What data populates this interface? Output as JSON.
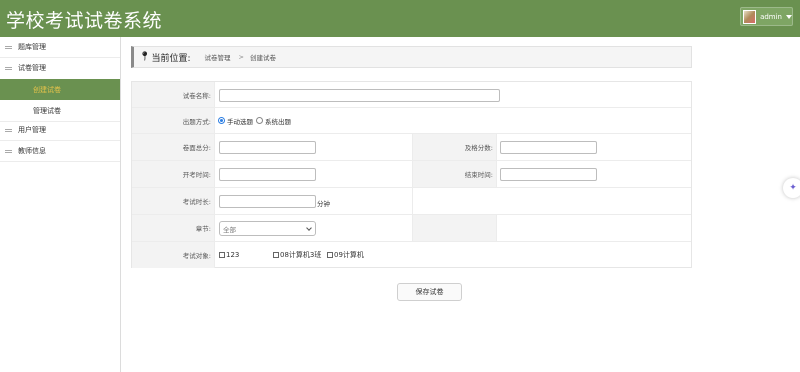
{
  "app": {
    "title": "学校考试试卷系统"
  },
  "user": {
    "name": "admin"
  },
  "sidebar": {
    "items": [
      {
        "label": "题库管理"
      },
      {
        "label": "试卷管理"
      },
      {
        "label": "用户管理"
      },
      {
        "label": "教师信息"
      }
    ],
    "subitems": [
      {
        "label": "创建试卷",
        "active": true
      },
      {
        "label": "管理试卷",
        "active": false
      }
    ]
  },
  "breadcrumb": {
    "prefix": "当前位置:",
    "parent": "试卷管理",
    "separator": ">",
    "current": "创建试卷"
  },
  "form": {
    "name_label": "试卷名称:",
    "name_value": "",
    "mode_label": "出题方式:",
    "mode_options": [
      "手动选题",
      "系统出题"
    ],
    "mode_selected": "手动选题",
    "total_label": "卷面总分:",
    "pass_label": "及格分数:",
    "start_label": "开考时间:",
    "end_label": "结束时间:",
    "duration_label": "考试时长:",
    "duration_unit": "分钟",
    "chapter_label": "章节:",
    "chapter_selected": "全部",
    "target_label": "考试对象:",
    "targets": [
      "123",
      "08计算机3班",
      "09计算机"
    ]
  },
  "actions": {
    "save_label": "保存试卷"
  },
  "colors": {
    "header": "#6a9150",
    "active_menu_text": "#e8c44a",
    "radio_accent": "#2d7fe3"
  }
}
